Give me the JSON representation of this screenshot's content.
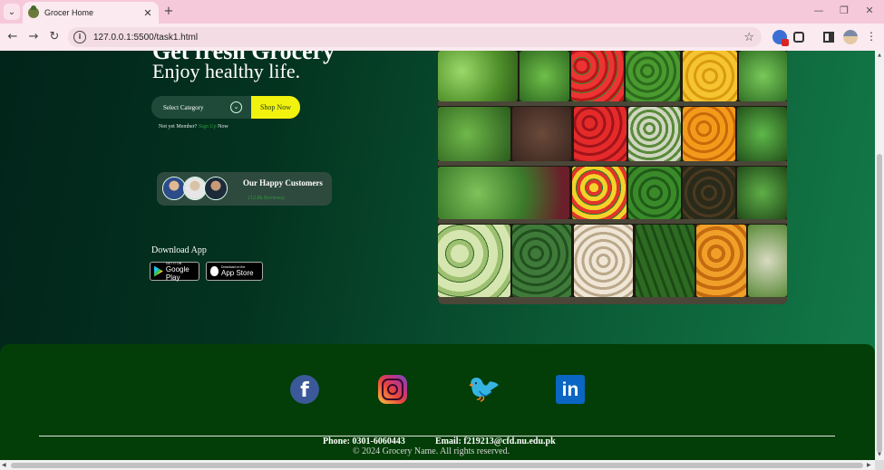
{
  "browser": {
    "tab_title": "Grocer Home",
    "url": "127.0.0.1:5500/task1.html",
    "new_tab_symbol": "+",
    "close_symbol": "✕",
    "back_symbol": "←",
    "forward_symbol": "→",
    "reload_symbol": "↻",
    "star_symbol": "☆",
    "menu_symbol": "⋮",
    "min_symbol": "—",
    "max_symbol": "❐",
    "winclose_symbol": "✕"
  },
  "hero": {
    "title": "Get fresh Grocery",
    "subtitle": "Enjoy healthy life.",
    "category_placeholder": "Select Category",
    "shop_button": "Shop Now",
    "member_prefix": "Not yet Member?",
    "signup_link": "Sign Up",
    "member_suffix": "Now"
  },
  "customers": {
    "title": "Our Happy Customers",
    "subtitle": "(12.8k Reviews)"
  },
  "download": {
    "title": "Download App",
    "google_small": "GET IT ON",
    "google_big": "Google Play",
    "apple_small": "Download on the",
    "apple_big": "App Store"
  },
  "footer": {
    "social": [
      "facebook-icon",
      "instagram-icon",
      "twitter-icon",
      "linkedin-icon"
    ],
    "facebook_glyph": "f",
    "twitter_glyph": "🐦",
    "linkedin_glyph": "in",
    "phone": "Phone: 0301-6060443",
    "email": "Email: f219213@cfd.nu.edu.pk",
    "copyright": "© 2024 Grocery Name. All rights reserved."
  },
  "colors": {
    "bg_dark": "#02241a",
    "bg_light": "#137a48",
    "shop_button": "#f2f20f",
    "footer": "#033d07",
    "link": "#2e9a3a"
  }
}
